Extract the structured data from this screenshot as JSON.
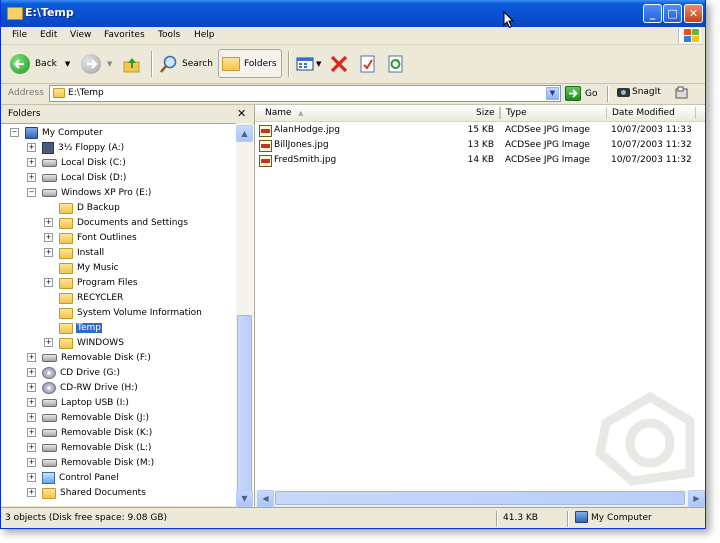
{
  "window": {
    "title": "E:\\Temp"
  },
  "menu": [
    "File",
    "Edit",
    "View",
    "Favorites",
    "Tools",
    "Help"
  ],
  "toolbar": {
    "back_label": "Back",
    "search_label": "Search",
    "folders_label": "Folders"
  },
  "address": {
    "label": "Address",
    "path": "E:\\Temp",
    "go_label": "Go",
    "snagit_label": "SnagIt"
  },
  "folders_pane": {
    "title": "Folders",
    "tree": [
      {
        "label": "My Computer",
        "icon": "computer-icon"
      },
      {
        "label": "3½ Floppy (A:)",
        "icon": "floppy-icon"
      },
      {
        "label": "Local Disk (C:)",
        "icon": "drive-icon"
      },
      {
        "label": "Local Disk (D:)",
        "icon": "drive-icon"
      },
      {
        "label": "Windows XP Pro (E:)",
        "icon": "drive-icon"
      },
      {
        "label": "D Backup",
        "icon": "folder-icon"
      },
      {
        "label": "Documents and Settings",
        "icon": "folder-icon"
      },
      {
        "label": "Font Outlines",
        "icon": "folder-icon"
      },
      {
        "label": "Install",
        "icon": "folder-icon"
      },
      {
        "label": "My Music",
        "icon": "folder-icon"
      },
      {
        "label": "Program Files",
        "icon": "folder-icon"
      },
      {
        "label": "RECYCLER",
        "icon": "folder-icon"
      },
      {
        "label": "System Volume Information",
        "icon": "folder-icon"
      },
      {
        "label": "Temp",
        "icon": "folder-icon"
      },
      {
        "label": "WINDOWS",
        "icon": "folder-icon"
      },
      {
        "label": "Removable Disk (F:)",
        "icon": "removable-drive-icon"
      },
      {
        "label": "CD Drive (G:)",
        "icon": "cd-drive-icon"
      },
      {
        "label": "CD-RW Drive (H:)",
        "icon": "cd-drive-icon"
      },
      {
        "label": "Laptop USB (I:)",
        "icon": "drive-icon"
      },
      {
        "label": "Removable Disk (J:)",
        "icon": "drive-icon"
      },
      {
        "label": "Removable Disk (K:)",
        "icon": "drive-icon"
      },
      {
        "label": "Removable Disk (L:)",
        "icon": "drive-icon"
      },
      {
        "label": "Removable Disk (M:)",
        "icon": "drive-icon"
      },
      {
        "label": "Control Panel",
        "icon": "control-panel-icon"
      },
      {
        "label": "Shared Documents",
        "icon": "folder-icon"
      }
    ]
  },
  "file_list": {
    "columns": [
      "Name",
      "Size",
      "Type",
      "Date Modified"
    ],
    "rows": [
      {
        "name": "AlanHodge.jpg",
        "size": "15 KB",
        "type": "ACDSee JPG Image",
        "date": "10/07/2003 11:33"
      },
      {
        "name": "BillJones.jpg",
        "size": "13 KB",
        "type": "ACDSee JPG Image",
        "date": "10/07/2003 11:32"
      },
      {
        "name": "FredSmith.jpg",
        "size": "14 KB",
        "type": "ACDSee JPG Image",
        "date": "10/07/2003 11:32"
      }
    ]
  },
  "status": {
    "objects": "3 objects (Disk free space: 9.08 GB)",
    "size": "41.3 KB",
    "location": "My Computer"
  },
  "colors": {
    "title_blue": "#0a4fd0",
    "selection": "#316ac5",
    "chrome": "#ece9d8"
  }
}
